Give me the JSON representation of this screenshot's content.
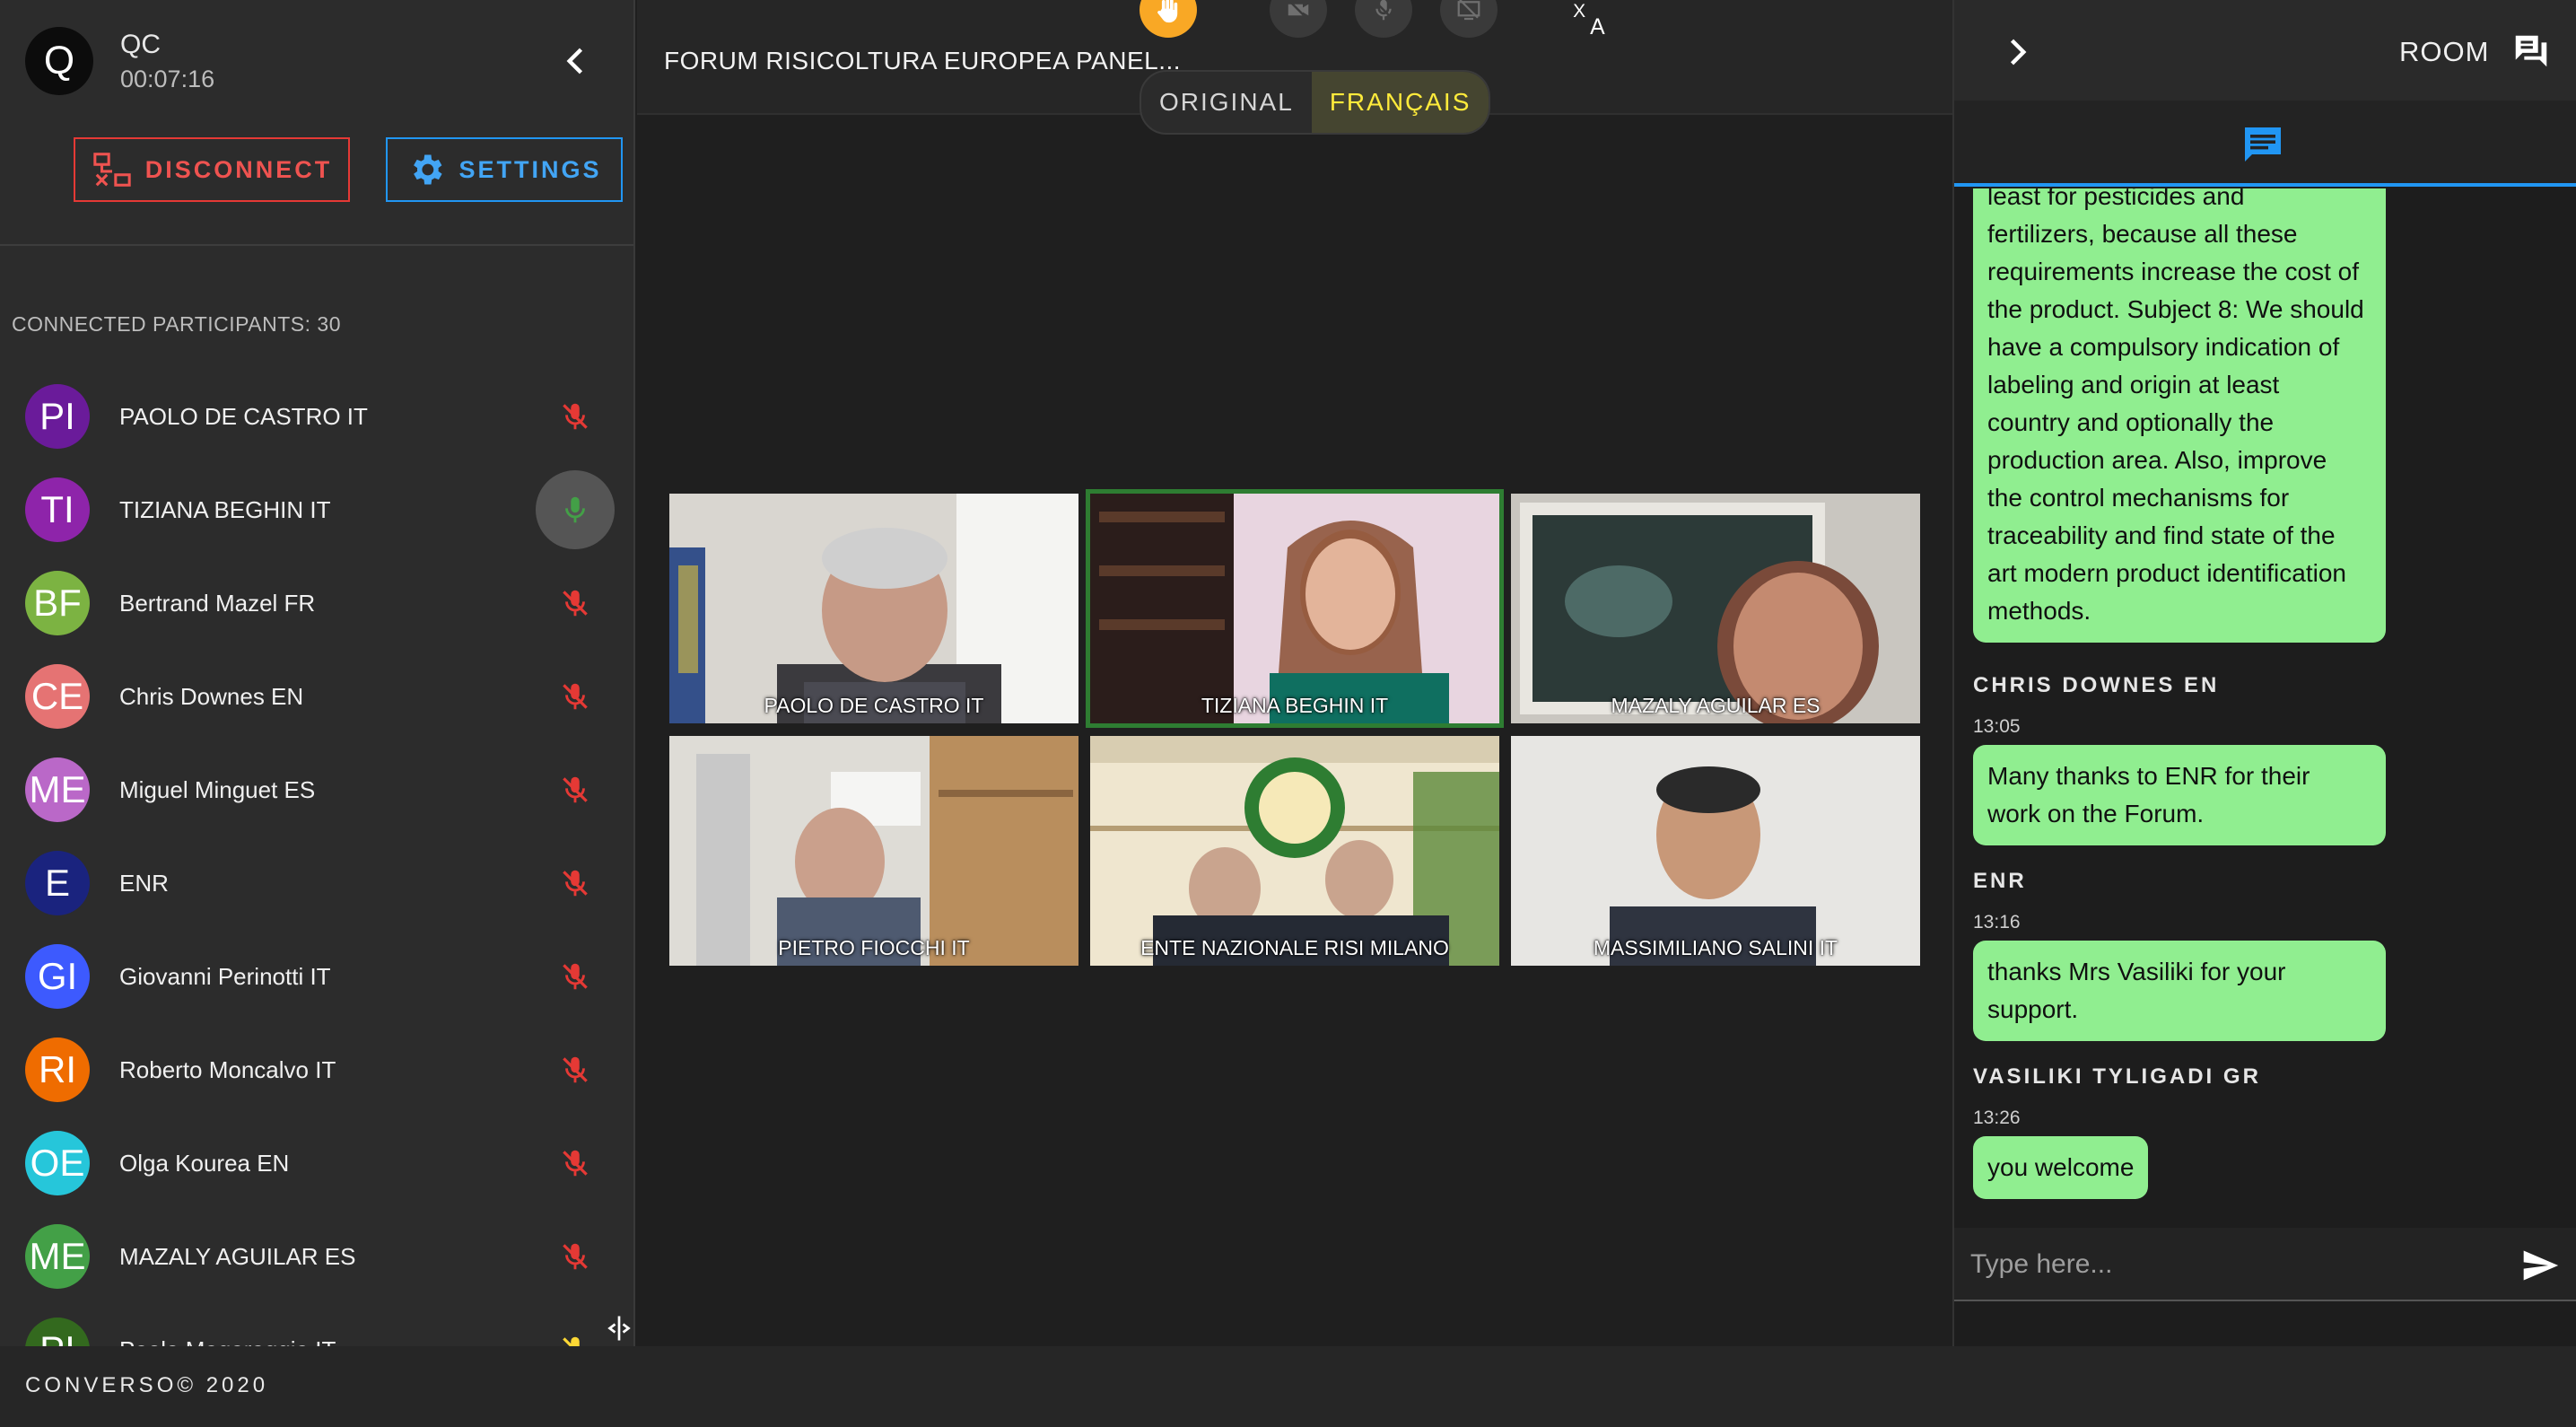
{
  "user": {
    "initial": "Q",
    "name": "QC",
    "timer": "00:07:16"
  },
  "sidebar": {
    "disconnect_label": "DISCONNECT",
    "settings_label": "SETTINGS",
    "participants_count": "CONNECTED PARTICIPANTS: 30",
    "participants": [
      {
        "initials": "PI",
        "name": "PAOLO DE CASTRO IT",
        "color": "#6a1b9a",
        "mic": "muted"
      },
      {
        "initials": "TI",
        "name": "TIZIANA BEGHIN IT",
        "color": "#8e24aa",
        "mic": "active"
      },
      {
        "initials": "BF",
        "name": "Bertrand Mazel FR",
        "color": "#7cb342",
        "mic": "muted"
      },
      {
        "initials": "CE",
        "name": "Chris Downes EN",
        "color": "#e57373",
        "mic": "muted"
      },
      {
        "initials": "ME",
        "name": "Miguel Minguet ES",
        "color": "#ba68c8",
        "mic": "muted"
      },
      {
        "initials": "E",
        "name": "ENR",
        "color": "#1a237e",
        "mic": "muted"
      },
      {
        "initials": "GI",
        "name": "Giovanni Perinotti IT",
        "color": "#3d5afe",
        "mic": "muted"
      },
      {
        "initials": "RI",
        "name": "Roberto Moncalvo IT",
        "color": "#ef6c00",
        "mic": "muted"
      },
      {
        "initials": "OE",
        "name": "Olga Kourea EN",
        "color": "#26c6da",
        "mic": "muted"
      },
      {
        "initials": "ME",
        "name": "MAZALY AGUILAR ES",
        "color": "#43a047",
        "mic": "muted"
      },
      {
        "initials": "PI",
        "name": "Paolo Magaraggia IT",
        "color": "#33691e",
        "mic": "yellow"
      }
    ]
  },
  "topbar": {
    "title": "FORUM RISICOLTURA EUROPEA PANEL...",
    "lang_original": "ORIGINAL",
    "lang_translated": "FRANÇAIS"
  },
  "videos": [
    {
      "label": "PAOLO DE CASTRO IT"
    },
    {
      "label": "TIZIANA BEGHIN IT"
    },
    {
      "label": "MAZALY AGUILAR ES"
    },
    {
      "label": "PIETRO FIOCCHI IT"
    },
    {
      "label": "ENTE NAZIONALE RISI MILANO"
    },
    {
      "label": "MASSIMILIANO SALINI IT"
    }
  ],
  "chat": {
    "room_label": "ROOM",
    "long_message": [
      "least for pesticides and",
      "fertilizers, because all these",
      "requirements increase the cost of",
      "the product. Subject 8: We should",
      "have a compulsory indication of",
      "labeling and origin at least",
      "country and optionally the",
      "production area. Also, improve",
      "the control mechanisms for",
      "traceability and find state of the",
      "art modern product identification",
      "methods."
    ],
    "messages": [
      {
        "sender": "CHRIS DOWNES EN",
        "time": "13:05",
        "lines": [
          "Many thanks to ENR for their",
          "work on the Forum."
        ]
      },
      {
        "sender": "ENR",
        "time": "13:16",
        "lines": [
          "thanks Mrs Vasiliki for your",
          "support."
        ]
      },
      {
        "sender": "VASILIKI TYLIGADI GR",
        "time": "13:26",
        "lines": [
          "you welcome"
        ]
      }
    ],
    "input_placeholder": "Type here..."
  },
  "footer": {
    "text": "CONVERSO© 2020"
  },
  "colors": {
    "accent_blue": "#2196f3",
    "danger_red": "#e53935",
    "speaking_green": "#2e7d32",
    "bubble_green": "#90ee90",
    "hand_orange": "#f9a825"
  }
}
